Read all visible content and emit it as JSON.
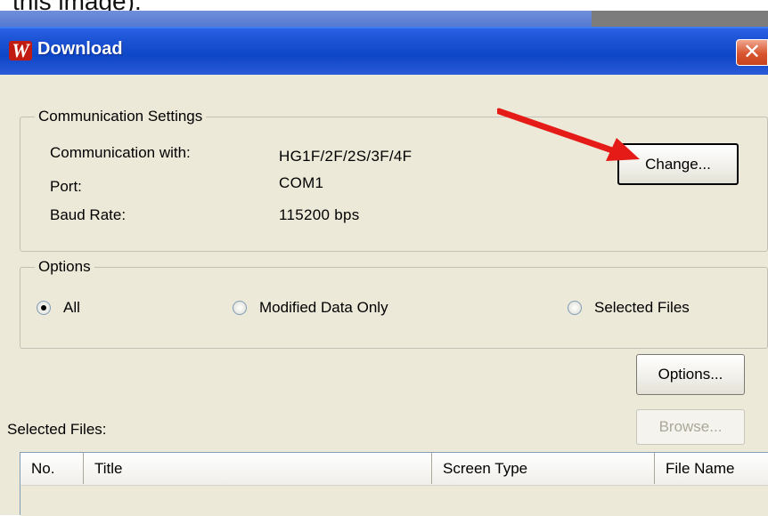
{
  "caption": "this image).",
  "window": {
    "title": "Download",
    "close_glyph": "✕",
    "app_icon_letter": "W"
  },
  "comm": {
    "legend": "Communication Settings",
    "rows": [
      {
        "label": "Communication with:",
        "value": "HG1F/2F/2S/3F/4F"
      },
      {
        "label": "Port:",
        "value": "COM1"
      },
      {
        "label": "Baud Rate:",
        "value": "115200 bps"
      }
    ],
    "change_button": "Change..."
  },
  "options": {
    "legend": "Options",
    "radios": [
      {
        "label": "All",
        "checked": true
      },
      {
        "label": "Modified Data Only",
        "checked": false
      },
      {
        "label": "Selected Files",
        "checked": false
      }
    ],
    "options_button": "Options..."
  },
  "files": {
    "label": "Selected Files:",
    "browse_button": "Browse...",
    "columns": [
      "No.",
      "Title",
      "Screen Type",
      "File Name"
    ]
  },
  "colors": {
    "annotation_arrow": "#e41b17",
    "titlebar": "#0d46c6",
    "dialog_bg": "#ece9d8"
  }
}
